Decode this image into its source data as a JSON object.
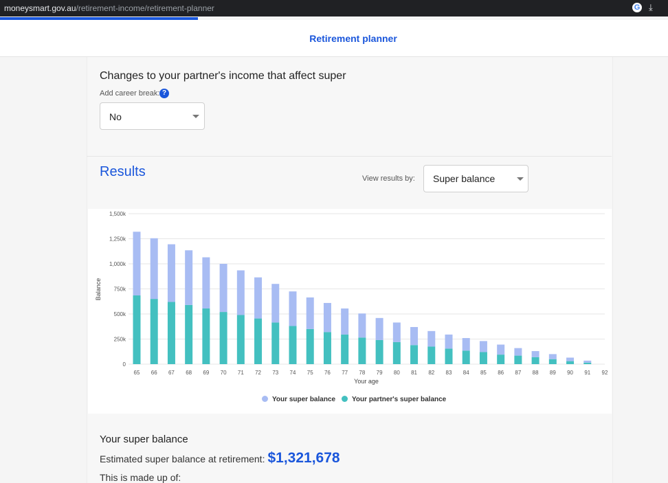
{
  "browser": {
    "url_host": "moneysmart.gov.au",
    "url_path": "/retirement-income/retirement-planner"
  },
  "header": {
    "title": "Retirement planner"
  },
  "partner_section": {
    "heading": "Changes to your partner's income that affect super",
    "career_break_label": "Add career break:",
    "help_icon_text": "?",
    "career_break_value": "No"
  },
  "results": {
    "heading": "Results",
    "view_by_label": "View results by:",
    "view_by_value": "Super balance"
  },
  "chart_data": {
    "type": "bar",
    "stacked": true,
    "xlabel": "Your age",
    "ylabel": "Balance",
    "ylim": [
      0,
      1500000
    ],
    "y_ticks": [
      0,
      250000,
      500000,
      750000,
      1000000,
      1250000,
      1500000
    ],
    "y_tick_labels": [
      "0",
      "250k",
      "500k",
      "750k",
      "1,000k",
      "1,250k",
      "1,500k"
    ],
    "categories": [
      "65",
      "66",
      "67",
      "68",
      "69",
      "70",
      "71",
      "72",
      "73",
      "74",
      "75",
      "76",
      "77",
      "78",
      "79",
      "80",
      "81",
      "82",
      "83",
      "84",
      "85",
      "86",
      "87",
      "88",
      "89",
      "90",
      "91",
      "92"
    ],
    "series": [
      {
        "name": "Your partner's super balance",
        "color": "#43c0c0",
        "values": [
          685000,
          650000,
          620000,
          590000,
          555000,
          520000,
          490000,
          455000,
          415000,
          380000,
          350000,
          320000,
          295000,
          265000,
          240000,
          220000,
          190000,
          175000,
          155000,
          135000,
          120000,
          95000,
          85000,
          70000,
          50000,
          30000,
          15000,
          0
        ]
      },
      {
        "name": "Your super balance",
        "color": "#a8bcf3",
        "values": [
          635000,
          605000,
          575000,
          545000,
          510000,
          480000,
          445000,
          410000,
          385000,
          345000,
          315000,
          290000,
          260000,
          240000,
          220000,
          195000,
          180000,
          155000,
          140000,
          125000,
          110000,
          100000,
          75000,
          60000,
          50000,
          35000,
          20000,
          0
        ]
      }
    ],
    "legend": [
      {
        "label": "Your super balance",
        "color": "#a8bcf3"
      },
      {
        "label": "Your partner's super balance",
        "color": "#43c0c0"
      }
    ],
    "legend_position": "bottom",
    "grid": true
  },
  "summary": {
    "heading": "Your super balance",
    "estimate_label": "Estimated super balance at retirement:",
    "estimate_value": "$1,321,678",
    "made_up_label": "This is made up of:"
  }
}
